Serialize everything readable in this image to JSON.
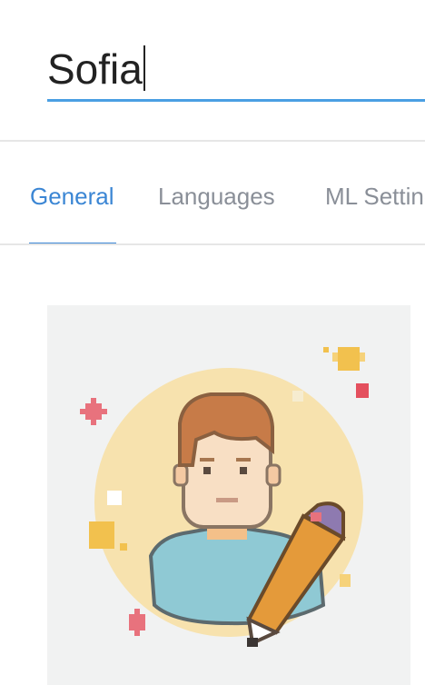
{
  "name_field": {
    "value": "Sofia"
  },
  "tabs": [
    {
      "label": "General",
      "active": true
    },
    {
      "label": "Languages",
      "active": false
    },
    {
      "label": "ML Settings",
      "active": false
    }
  ],
  "colors": {
    "accent": "#3b86d4",
    "field_underline": "#4a9fe3",
    "tab_inactive": "#8a8f98",
    "avatar_background": "#f1f2f2"
  },
  "avatar": {
    "icon": "user-avatar-edit-icon"
  }
}
